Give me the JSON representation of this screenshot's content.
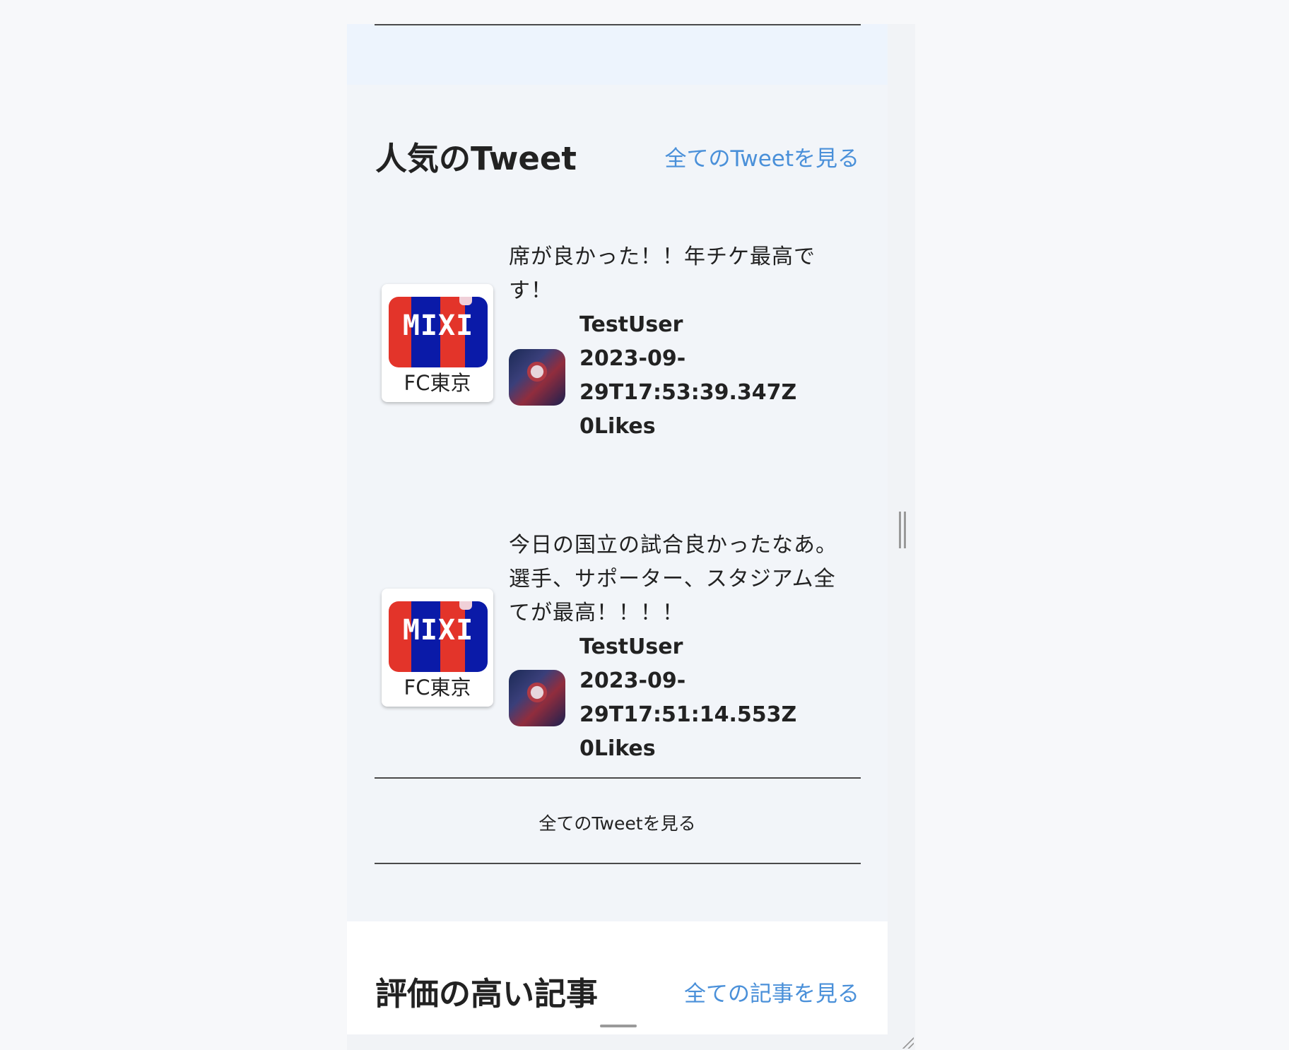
{
  "popular_tweets": {
    "title": "人気のTweet",
    "view_all_link": "全てのTweetを見る",
    "footer_link": "全てのTweetを見る",
    "items": [
      {
        "team_logo_text": "MIXI",
        "team_name": "FC東京",
        "text": "席が良かった！！年チケ最高です！",
        "user": "TestUser",
        "timestamp_line1": "2023-09-",
        "timestamp_line2": "29T17:53:39.347Z",
        "likes": "0Likes"
      },
      {
        "team_logo_text": "MIXI",
        "team_name": "FC東京",
        "text": "今日の国立の試合良かったなあ。選手、サポーター、スタジアム全てが最高！！！！",
        "user": "TestUser",
        "timestamp_line1": "2023-09-",
        "timestamp_line2": "29T17:51:14.553Z",
        "likes": "0Likes"
      }
    ]
  },
  "top_articles": {
    "title": "評価の高い記事",
    "view_all_link": "全ての記事を見る"
  },
  "colors": {
    "link": "#4a90d9",
    "section_bg": "#f2f5f9",
    "top_band_bg": "#edf4fd"
  },
  "icons": {
    "scroll_handle": "vertical-drag-handle",
    "resize": "resize-grip-icon"
  }
}
